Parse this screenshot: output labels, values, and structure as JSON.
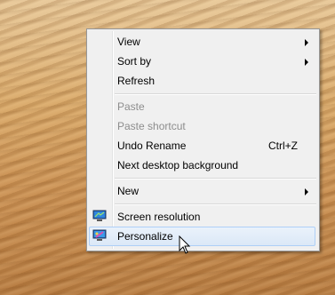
{
  "menu": {
    "items": [
      {
        "label": "View",
        "submenu": true
      },
      {
        "label": "Sort by",
        "submenu": true
      },
      {
        "label": "Refresh"
      },
      {
        "label": "Paste",
        "disabled": true
      },
      {
        "label": "Paste shortcut",
        "disabled": true
      },
      {
        "label": "Undo Rename",
        "shortcut": "Ctrl+Z"
      },
      {
        "label": "Next desktop background"
      },
      {
        "label": "New",
        "submenu": true
      },
      {
        "label": "Screen resolution",
        "icon": "monitor-icon"
      },
      {
        "label": "Personalize",
        "icon": "personalize-icon",
        "highlighted": true
      }
    ]
  },
  "colors": {
    "menu_background": "#f0f0f0",
    "highlight_border": "#aecff7",
    "disabled_text": "#8d8d8d"
  }
}
